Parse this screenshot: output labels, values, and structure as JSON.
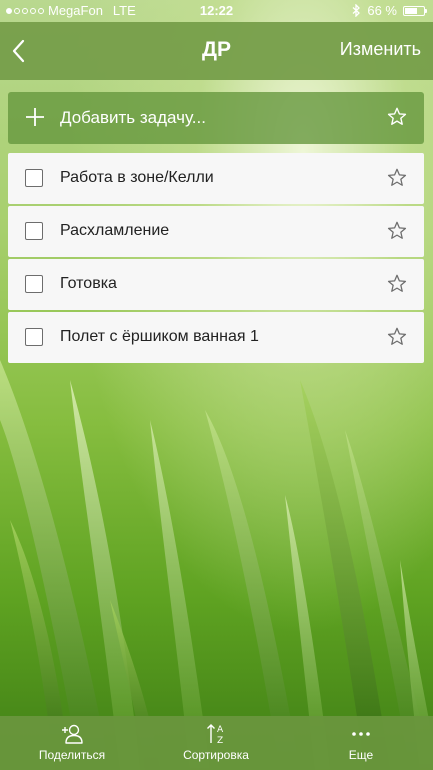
{
  "status_bar": {
    "carrier": "MegaFon",
    "network": "LTE",
    "time": "12:22",
    "battery": "66 %",
    "battery_level": 0.66
  },
  "nav": {
    "title": "ДР",
    "edit_label": "Изменить"
  },
  "add_task": {
    "label": "Добавить задачу..."
  },
  "tasks": [
    {
      "label": "Работа в зоне/Келли"
    },
    {
      "label": "Расхламление"
    },
    {
      "label": "Готовка"
    },
    {
      "label": "Полет с ёршиком ванная 1"
    }
  ],
  "toolbar": {
    "share_label": "Поделиться",
    "sort_label": "Сортировка",
    "more_label": "Еще"
  },
  "colors": {
    "bar_green": "#769e4a",
    "row_background": "#f7f7f7"
  }
}
